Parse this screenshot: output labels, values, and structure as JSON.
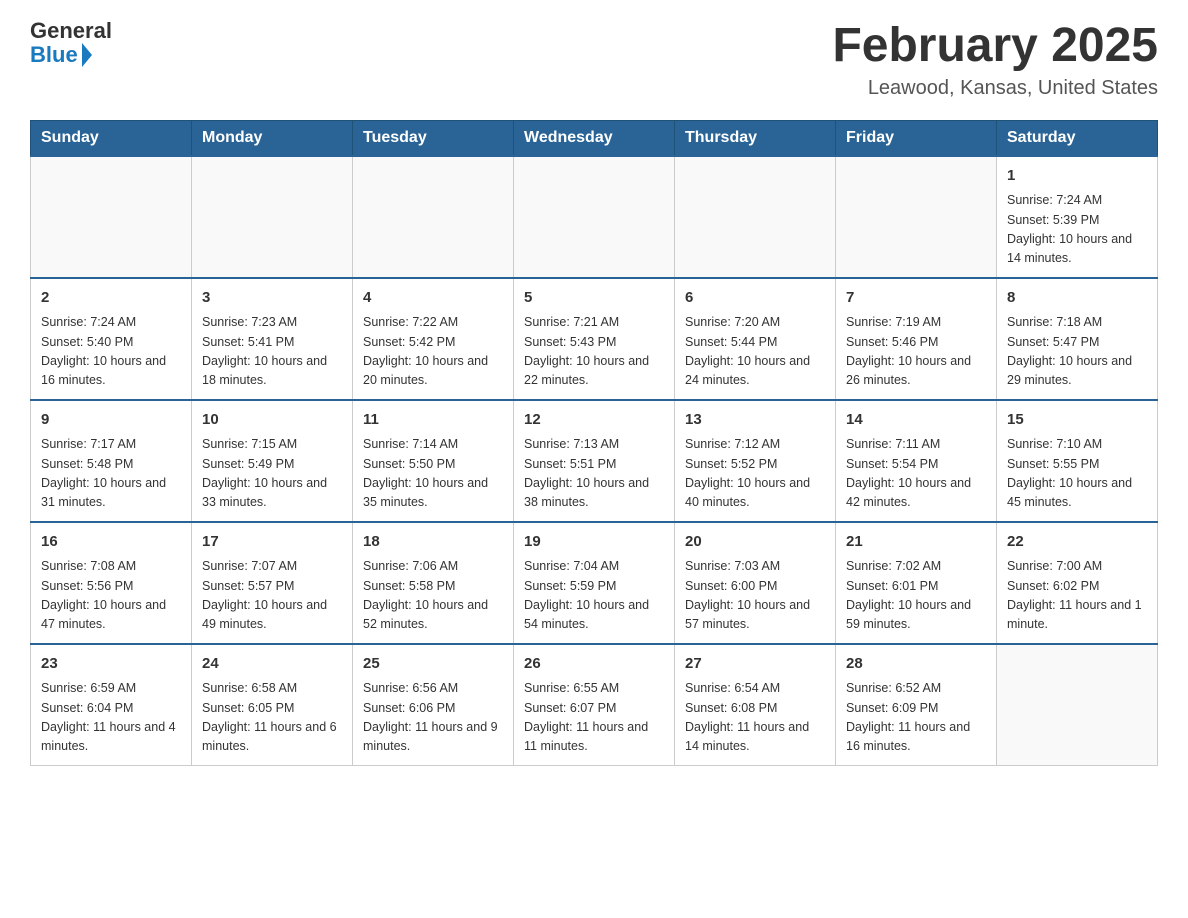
{
  "logo": {
    "general": "General",
    "blue": "Blue"
  },
  "header": {
    "month": "February 2025",
    "location": "Leawood, Kansas, United States"
  },
  "weekdays": [
    "Sunday",
    "Monday",
    "Tuesday",
    "Wednesday",
    "Thursday",
    "Friday",
    "Saturday"
  ],
  "weeks": [
    [
      {
        "day": "",
        "info": ""
      },
      {
        "day": "",
        "info": ""
      },
      {
        "day": "",
        "info": ""
      },
      {
        "day": "",
        "info": ""
      },
      {
        "day": "",
        "info": ""
      },
      {
        "day": "",
        "info": ""
      },
      {
        "day": "1",
        "info": "Sunrise: 7:24 AM\nSunset: 5:39 PM\nDaylight: 10 hours and 14 minutes."
      }
    ],
    [
      {
        "day": "2",
        "info": "Sunrise: 7:24 AM\nSunset: 5:40 PM\nDaylight: 10 hours and 16 minutes."
      },
      {
        "day": "3",
        "info": "Sunrise: 7:23 AM\nSunset: 5:41 PM\nDaylight: 10 hours and 18 minutes."
      },
      {
        "day": "4",
        "info": "Sunrise: 7:22 AM\nSunset: 5:42 PM\nDaylight: 10 hours and 20 minutes."
      },
      {
        "day": "5",
        "info": "Sunrise: 7:21 AM\nSunset: 5:43 PM\nDaylight: 10 hours and 22 minutes."
      },
      {
        "day": "6",
        "info": "Sunrise: 7:20 AM\nSunset: 5:44 PM\nDaylight: 10 hours and 24 minutes."
      },
      {
        "day": "7",
        "info": "Sunrise: 7:19 AM\nSunset: 5:46 PM\nDaylight: 10 hours and 26 minutes."
      },
      {
        "day": "8",
        "info": "Sunrise: 7:18 AM\nSunset: 5:47 PM\nDaylight: 10 hours and 29 minutes."
      }
    ],
    [
      {
        "day": "9",
        "info": "Sunrise: 7:17 AM\nSunset: 5:48 PM\nDaylight: 10 hours and 31 minutes."
      },
      {
        "day": "10",
        "info": "Sunrise: 7:15 AM\nSunset: 5:49 PM\nDaylight: 10 hours and 33 minutes."
      },
      {
        "day": "11",
        "info": "Sunrise: 7:14 AM\nSunset: 5:50 PM\nDaylight: 10 hours and 35 minutes."
      },
      {
        "day": "12",
        "info": "Sunrise: 7:13 AM\nSunset: 5:51 PM\nDaylight: 10 hours and 38 minutes."
      },
      {
        "day": "13",
        "info": "Sunrise: 7:12 AM\nSunset: 5:52 PM\nDaylight: 10 hours and 40 minutes."
      },
      {
        "day": "14",
        "info": "Sunrise: 7:11 AM\nSunset: 5:54 PM\nDaylight: 10 hours and 42 minutes."
      },
      {
        "day": "15",
        "info": "Sunrise: 7:10 AM\nSunset: 5:55 PM\nDaylight: 10 hours and 45 minutes."
      }
    ],
    [
      {
        "day": "16",
        "info": "Sunrise: 7:08 AM\nSunset: 5:56 PM\nDaylight: 10 hours and 47 minutes."
      },
      {
        "day": "17",
        "info": "Sunrise: 7:07 AM\nSunset: 5:57 PM\nDaylight: 10 hours and 49 minutes."
      },
      {
        "day": "18",
        "info": "Sunrise: 7:06 AM\nSunset: 5:58 PM\nDaylight: 10 hours and 52 minutes."
      },
      {
        "day": "19",
        "info": "Sunrise: 7:04 AM\nSunset: 5:59 PM\nDaylight: 10 hours and 54 minutes."
      },
      {
        "day": "20",
        "info": "Sunrise: 7:03 AM\nSunset: 6:00 PM\nDaylight: 10 hours and 57 minutes."
      },
      {
        "day": "21",
        "info": "Sunrise: 7:02 AM\nSunset: 6:01 PM\nDaylight: 10 hours and 59 minutes."
      },
      {
        "day": "22",
        "info": "Sunrise: 7:00 AM\nSunset: 6:02 PM\nDaylight: 11 hours and 1 minute."
      }
    ],
    [
      {
        "day": "23",
        "info": "Sunrise: 6:59 AM\nSunset: 6:04 PM\nDaylight: 11 hours and 4 minutes."
      },
      {
        "day": "24",
        "info": "Sunrise: 6:58 AM\nSunset: 6:05 PM\nDaylight: 11 hours and 6 minutes."
      },
      {
        "day": "25",
        "info": "Sunrise: 6:56 AM\nSunset: 6:06 PM\nDaylight: 11 hours and 9 minutes."
      },
      {
        "day": "26",
        "info": "Sunrise: 6:55 AM\nSunset: 6:07 PM\nDaylight: 11 hours and 11 minutes."
      },
      {
        "day": "27",
        "info": "Sunrise: 6:54 AM\nSunset: 6:08 PM\nDaylight: 11 hours and 14 minutes."
      },
      {
        "day": "28",
        "info": "Sunrise: 6:52 AM\nSunset: 6:09 PM\nDaylight: 11 hours and 16 minutes."
      },
      {
        "day": "",
        "info": ""
      }
    ]
  ]
}
